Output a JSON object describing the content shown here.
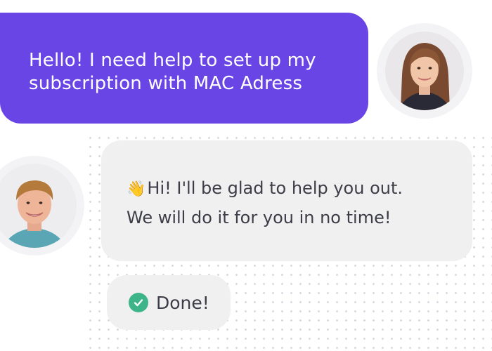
{
  "user_message": {
    "lines": [
      "Hello! I need help to set up my",
      "subscription with MAC Adress"
    ],
    "bubble_color": "#6a45e6",
    "avatar": "woman-avatar"
  },
  "agent_message": {
    "emoji": "👋",
    "lines": [
      "Hi! I'll be glad to help you out.",
      "We will do it for you in no time!"
    ],
    "avatar": "man-avatar"
  },
  "status": {
    "icon": "check-circle-icon",
    "label": "Done!",
    "color": "#3eb489"
  }
}
